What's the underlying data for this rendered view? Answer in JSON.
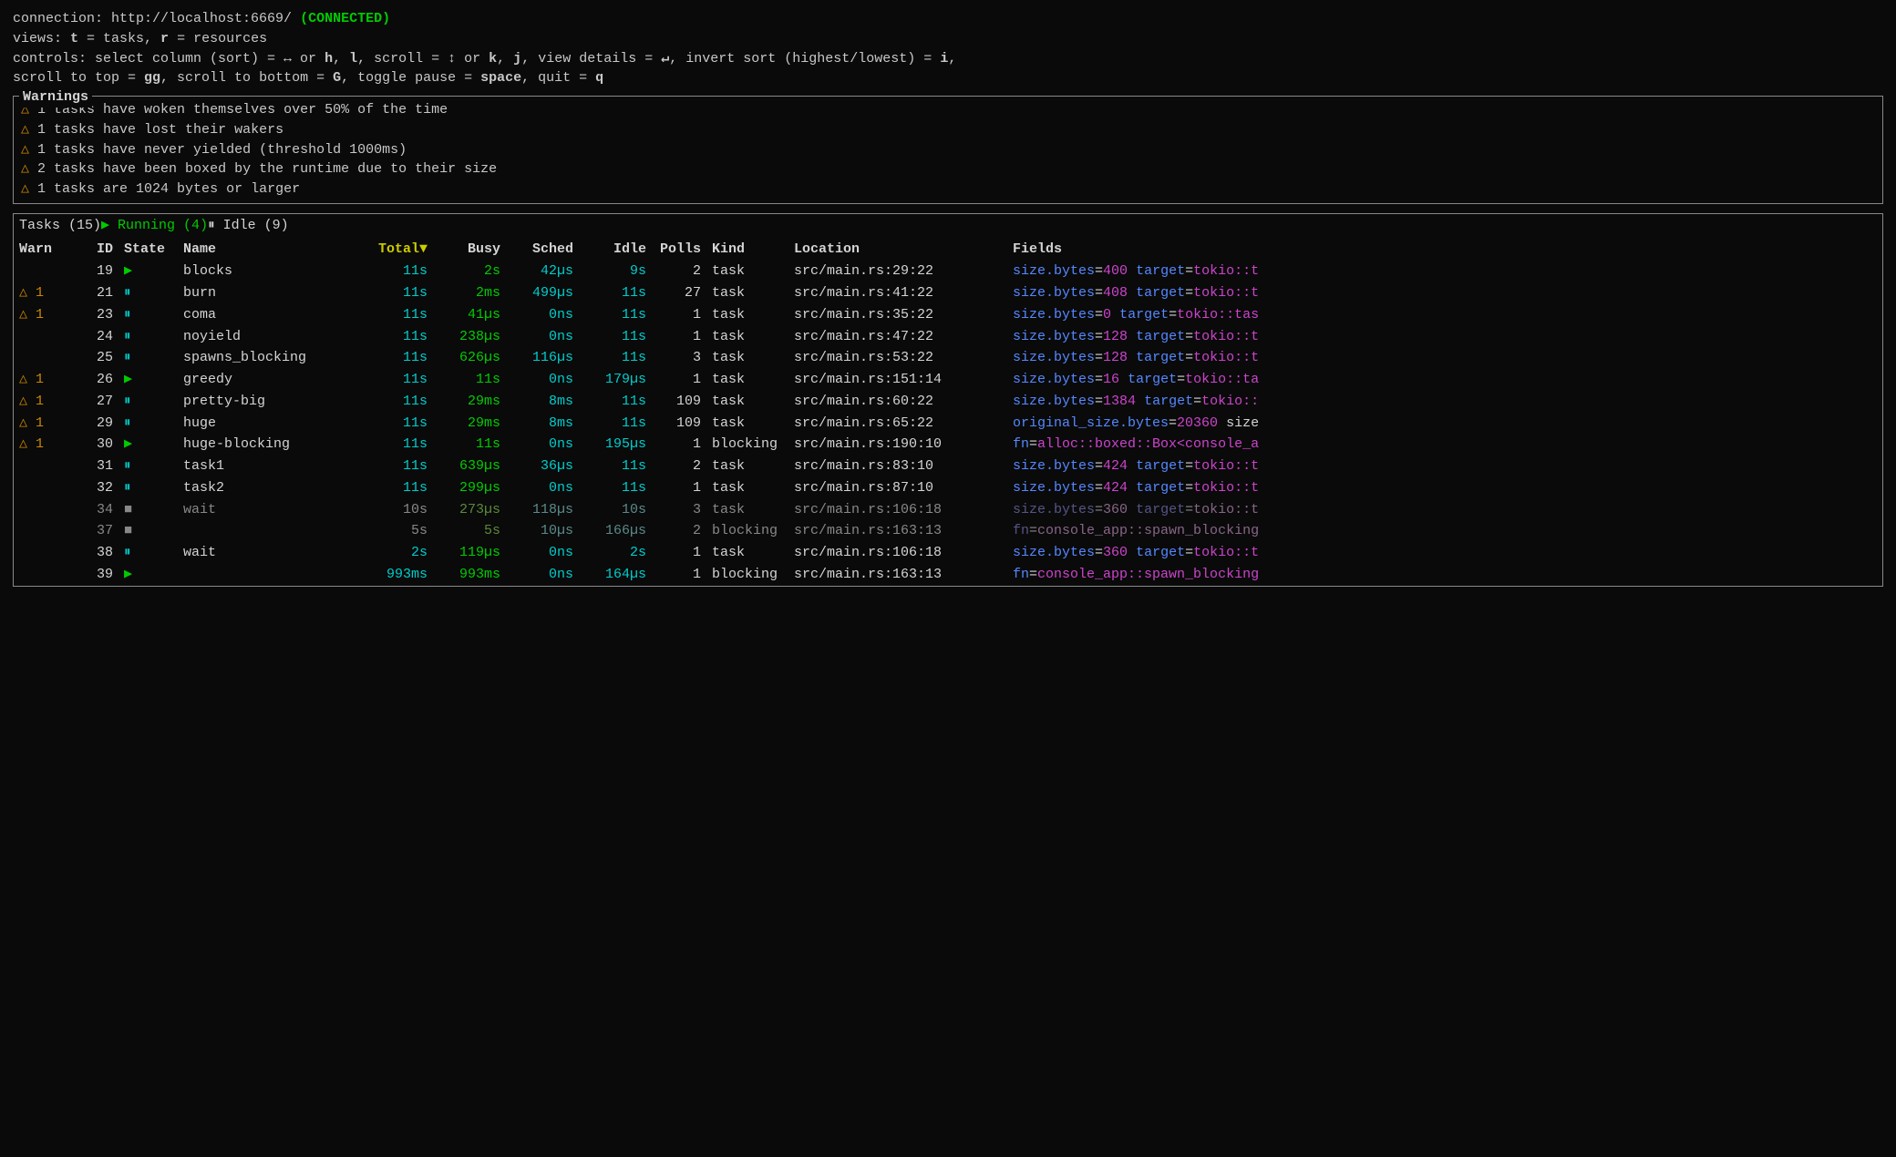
{
  "header": {
    "connection_label": "connection: http://localhost:6669/",
    "connected_status": "(CONNECTED)",
    "views_line": "views: t = tasks, r = resources",
    "controls_line1": "controls: select column (sort) = ↔ or h, l, scroll = ↕ or k, j, view details = ↵, invert sort (highest/lowest) = i,",
    "controls_line2": "scroll to top = gg, scroll to bottom = G, toggle pause = space, quit = q"
  },
  "warnings": {
    "title": "Warnings",
    "items": [
      "△ 1 tasks have woken themselves over 50% of the time",
      "△ 1 tasks have lost their wakers",
      "△ 1 tasks have never yielded (threshold 1000ms)",
      "△ 2 tasks have been boxed by the runtime due to their size",
      "△ 1 tasks are 1024 bytes or larger"
    ]
  },
  "tasks": {
    "title": "Tasks (15)",
    "running_label": "▶ Running (4)",
    "idle_label": "⏸ Idle (9)",
    "columns": {
      "warn": "Warn",
      "id": "ID",
      "state": "State",
      "name": "Name",
      "total": "Total▼",
      "busy": "Busy",
      "sched": "Sched",
      "idle": "Idle",
      "polls": "Polls",
      "kind": "Kind",
      "location": "Location",
      "fields": "Fields"
    },
    "rows": [
      {
        "warn": "",
        "id": "19",
        "state": "▶",
        "state_type": "run",
        "name": "blocks",
        "total": "11s",
        "busy": "2s",
        "sched": "42µs",
        "idle": "9s",
        "polls": "2",
        "kind": "task",
        "location": "src/main.rs:29:22",
        "fields": "size.bytes=400 target=tokio::t",
        "dim": false
      },
      {
        "warn": "△ 1",
        "id": "21",
        "state": "⏸",
        "state_type": "pause",
        "name": "burn",
        "total": "11s",
        "busy": "2ms",
        "sched": "499µs",
        "idle": "11s",
        "polls": "27",
        "kind": "task",
        "location": "src/main.rs:41:22",
        "fields": "size.bytes=408 target=tokio::t",
        "dim": false
      },
      {
        "warn": "△ 1",
        "id": "23",
        "state": "⏸",
        "state_type": "pause",
        "name": "coma",
        "total": "11s",
        "busy": "41µs",
        "sched": "0ns",
        "idle": "11s",
        "polls": "1",
        "kind": "task",
        "location": "src/main.rs:35:22",
        "fields": "size.bytes=0 target=tokio::tas",
        "dim": false
      },
      {
        "warn": "",
        "id": "24",
        "state": "⏸",
        "state_type": "pause",
        "name": "noyield",
        "total": "11s",
        "busy": "238µs",
        "sched": "0ns",
        "idle": "11s",
        "polls": "1",
        "kind": "task",
        "location": "src/main.rs:47:22",
        "fields": "size.bytes=128 target=tokio::t",
        "dim": false
      },
      {
        "warn": "",
        "id": "25",
        "state": "⏸",
        "state_type": "pause",
        "name": "spawns_blocking",
        "total": "11s",
        "busy": "626µs",
        "sched": "116µs",
        "idle": "11s",
        "polls": "3",
        "kind": "task",
        "location": "src/main.rs:53:22",
        "fields": "size.bytes=128 target=tokio::t",
        "dim": false
      },
      {
        "warn": "△ 1",
        "id": "26",
        "state": "▶",
        "state_type": "run",
        "name": "greedy",
        "total": "11s",
        "busy": "11s",
        "sched": "0ns",
        "idle": "179µs",
        "polls": "1",
        "kind": "task",
        "location": "src/main.rs:151:14",
        "fields": "size.bytes=16 target=tokio::ta",
        "dim": false
      },
      {
        "warn": "△ 1",
        "id": "27",
        "state": "⏸",
        "state_type": "pause",
        "name": "pretty-big",
        "total": "11s",
        "busy": "29ms",
        "sched": "8ms",
        "idle": "11s",
        "polls": "109",
        "kind": "task",
        "location": "src/main.rs:60:22",
        "fields": "size.bytes=1384 target=tokio::",
        "dim": false
      },
      {
        "warn": "△ 1",
        "id": "29",
        "state": "⏸",
        "state_type": "pause",
        "name": "huge",
        "total": "11s",
        "busy": "29ms",
        "sched": "8ms",
        "idle": "11s",
        "polls": "109",
        "kind": "task",
        "location": "src/main.rs:65:22",
        "fields": "original_size.bytes=20360 size",
        "dim": false
      },
      {
        "warn": "△ 1",
        "id": "30",
        "state": "▶",
        "state_type": "run",
        "name": "huge-blocking",
        "total": "11s",
        "busy": "11s",
        "sched": "0ns",
        "idle": "195µs",
        "polls": "1",
        "kind": "blocking",
        "location": "src/main.rs:190:10",
        "fields": "fn=alloc::boxed::Box<console_a",
        "dim": false
      },
      {
        "warn": "",
        "id": "31",
        "state": "⏸",
        "state_type": "pause",
        "name": "task1",
        "total": "11s",
        "busy": "639µs",
        "sched": "36µs",
        "idle": "11s",
        "polls": "2",
        "kind": "task",
        "location": "src/main.rs:83:10",
        "fields": "size.bytes=424 target=tokio::t",
        "dim": false
      },
      {
        "warn": "",
        "id": "32",
        "state": "⏸",
        "state_type": "pause",
        "name": "task2",
        "total": "11s",
        "busy": "299µs",
        "sched": "0ns",
        "idle": "11s",
        "polls": "1",
        "kind": "task",
        "location": "src/main.rs:87:10",
        "fields": "size.bytes=424 target=tokio::t",
        "dim": false
      },
      {
        "warn": "",
        "id": "34",
        "state": "■",
        "state_type": "idle",
        "name": "wait",
        "total": "10s",
        "busy": "273µs",
        "sched": "118µs",
        "idle": "10s",
        "polls": "3",
        "kind": "task",
        "location": "src/main.rs:106:18",
        "fields": "size.bytes=360 target=tokio::t",
        "dim": true
      },
      {
        "warn": "",
        "id": "37",
        "state": "■",
        "state_type": "idle",
        "name": "",
        "total": "5s",
        "busy": "5s",
        "sched": "10µs",
        "idle": "166µs",
        "polls": "2",
        "kind": "blocking",
        "location": "src/main.rs:163:13",
        "fields": "fn=console_app::spawn_blocking",
        "dim": true
      },
      {
        "warn": "",
        "id": "38",
        "state": "⏸",
        "state_type": "pause",
        "name": "wait",
        "total": "2s",
        "busy": "119µs",
        "sched": "0ns",
        "idle": "2s",
        "polls": "1",
        "kind": "task",
        "location": "src/main.rs:106:18",
        "fields": "size.bytes=360 target=tokio::t",
        "dim": false
      },
      {
        "warn": "",
        "id": "39",
        "state": "▶",
        "state_type": "run",
        "name": "",
        "total": "993ms",
        "busy": "993ms",
        "sched": "0ns",
        "idle": "164µs",
        "polls": "1",
        "kind": "blocking",
        "location": "src/main.rs:163:13",
        "fields": "fn=console_app::spawn_blocking",
        "dim": false
      }
    ]
  }
}
